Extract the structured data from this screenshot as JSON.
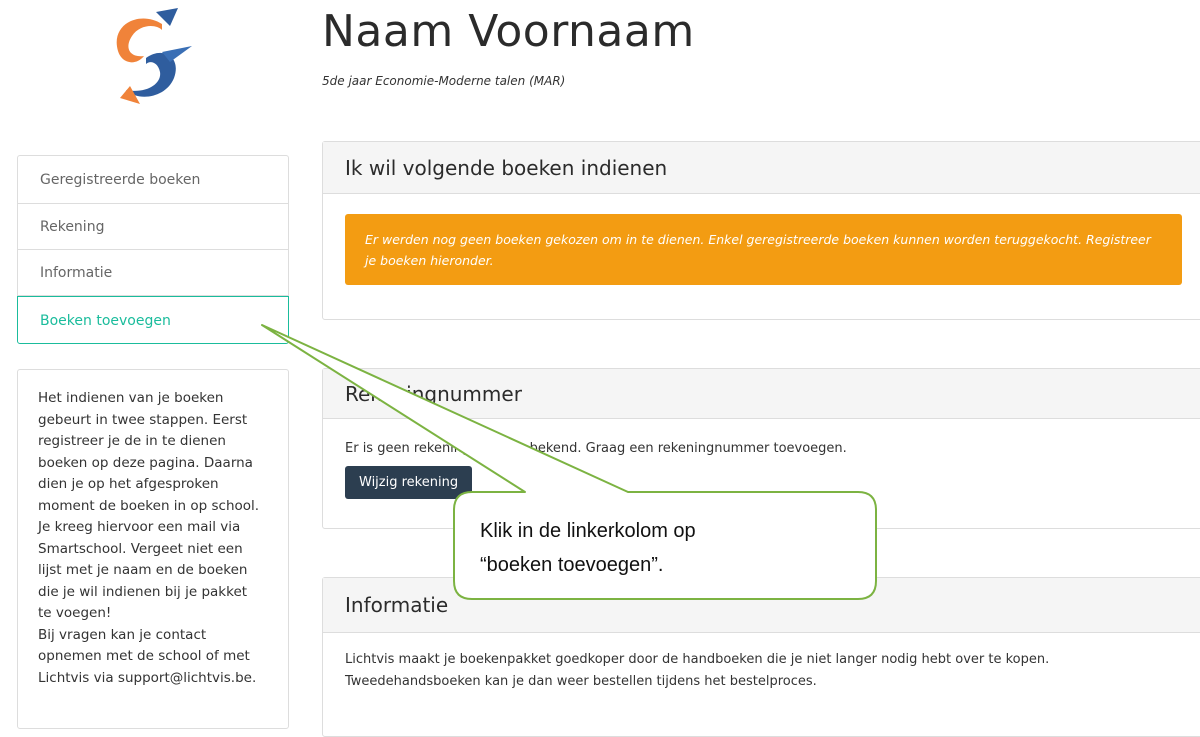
{
  "header": {
    "name": "Naam Voornaam",
    "class": "5de jaar Economie-Moderne talen (MAR)"
  },
  "sidebar": {
    "items": [
      {
        "label": "Geregistreerde boeken"
      },
      {
        "label": "Rekening"
      },
      {
        "label": "Informatie"
      },
      {
        "label": "Boeken toevoegen",
        "active": true
      }
    ],
    "help_lines": [
      "Het indienen van je boeken",
      "gebeurt in twee stappen. Eerst",
      "registreer je de in te dienen",
      "boeken op deze pagina. Daarna",
      "dien je op het afgesproken",
      "moment de boeken in op school.",
      "Je kreeg hiervoor een mail via",
      "Smartschool. Vergeet niet een",
      "lijst met je naam en de boeken",
      "die je wil indienen bij je pakket",
      "te voegen!",
      "Bij vragen kan je contact",
      "opnemen met de school of met",
      "Lichtvis via support@lichtvis.be."
    ]
  },
  "panels": {
    "submit": {
      "title": "Ik wil volgende boeken indienen",
      "warning": "Er werden nog geen boeken gekozen om in te dienen. Enkel geregistreerde boeken kunnen worden teruggekocht. Registreer je boeken hieronder."
    },
    "account": {
      "title": "Rekeningnummer",
      "text": "Er is geen rekeningnummer bekend. Graag een rekeningnummer toevoegen.",
      "button": "Wijzig rekening"
    },
    "info": {
      "title": "Informatie",
      "text_line1": "Lichtvis maakt je boekenpakket goedkoper door de handboeken die je niet langer nodig hebt over te kopen.",
      "text_line2": "Tweedehandsboeken kan je dan weer bestellen tijdens het bestelproces."
    }
  },
  "callout": {
    "line1": "Klik in de linkerkolom op",
    "line2": "“boeken toevoegen”."
  },
  "colors": {
    "accent": "#1abc9c",
    "warning": "#f39c12",
    "button": "#2c3e50",
    "callout_border": "#7cb342"
  }
}
